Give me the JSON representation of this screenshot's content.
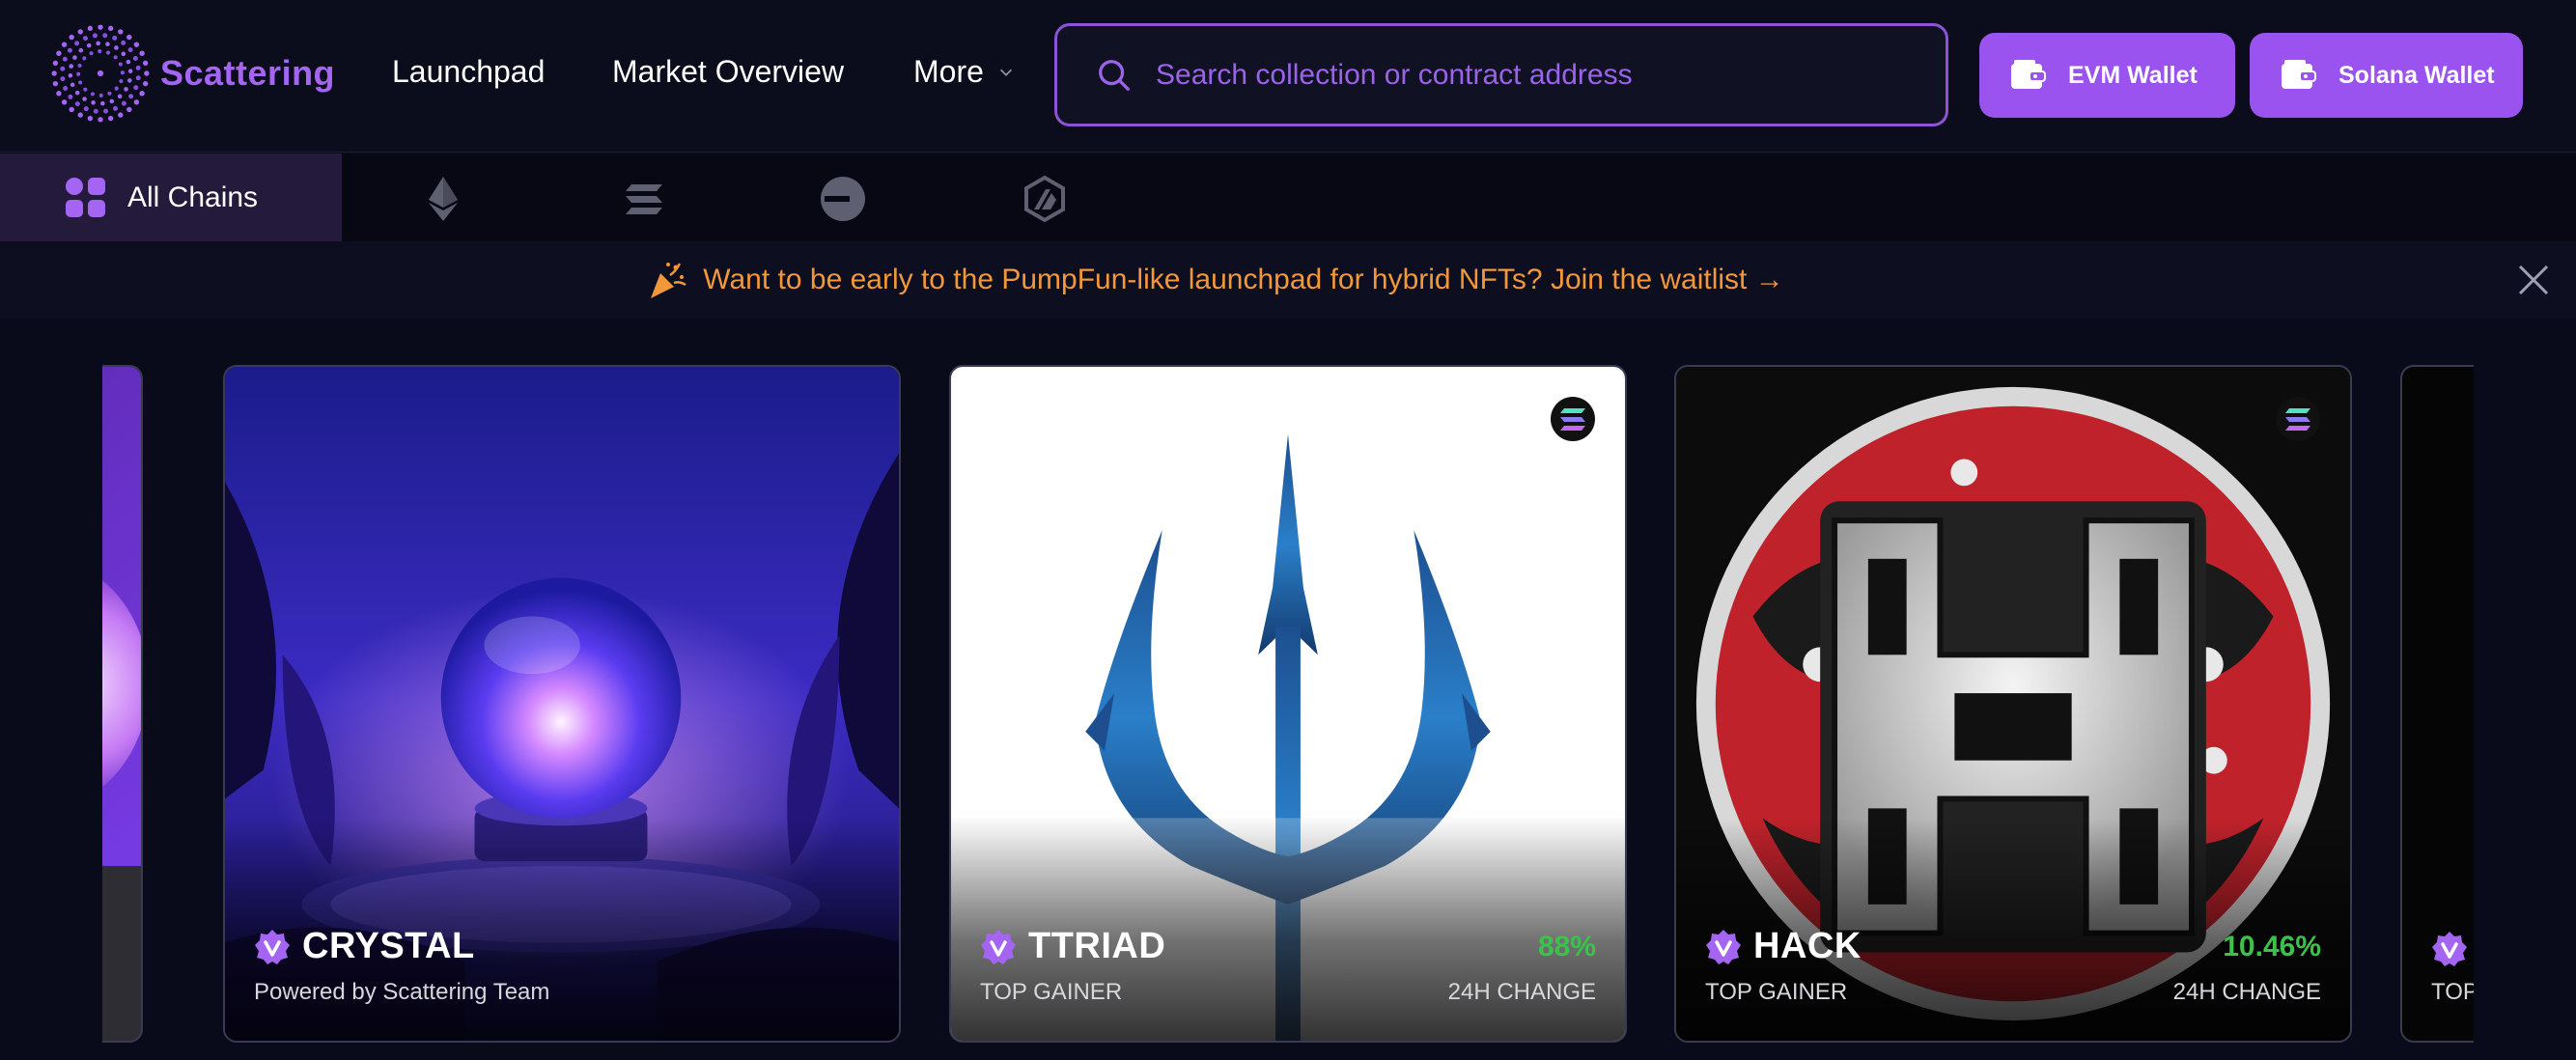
{
  "header": {
    "brand": "Scattering",
    "nav": {
      "launchpad": "Launchpad",
      "market_overview": "Market Overview",
      "more": "More"
    },
    "search_placeholder": "Search collection or contract address",
    "evm_wallet": "EVM Wallet",
    "solana_wallet": "Solana Wallet"
  },
  "chains": {
    "all_label": "All Chains",
    "icons": [
      "ethereum-icon",
      "solana-icon",
      "base-icon",
      "arbitrum-icon"
    ]
  },
  "banner": {
    "text": "Want to be early to the PumpFun-like launchpad for hybrid NFTs? Join the waitlist →"
  },
  "cards": [
    {
      "name": "CRYSTAL",
      "subtitle": "Powered by Scattering Team"
    },
    {
      "name": "TTRIAD",
      "subtitle": "TOP GAINER",
      "change": "88%",
      "change_label": "24H CHANGE",
      "chain": "solana-icon"
    },
    {
      "name": "HACK",
      "subtitle": "TOP GAINER",
      "change": "10.46%",
      "change_label": "24H CHANGE",
      "chain": "solana-icon"
    },
    {
      "subtitle": "TOP GAINER"
    }
  ],
  "colors": {
    "accent": "#9b53ef",
    "background": "#0a0b1a",
    "banner_text": "#f2973a",
    "positive": "#3bc24a"
  }
}
